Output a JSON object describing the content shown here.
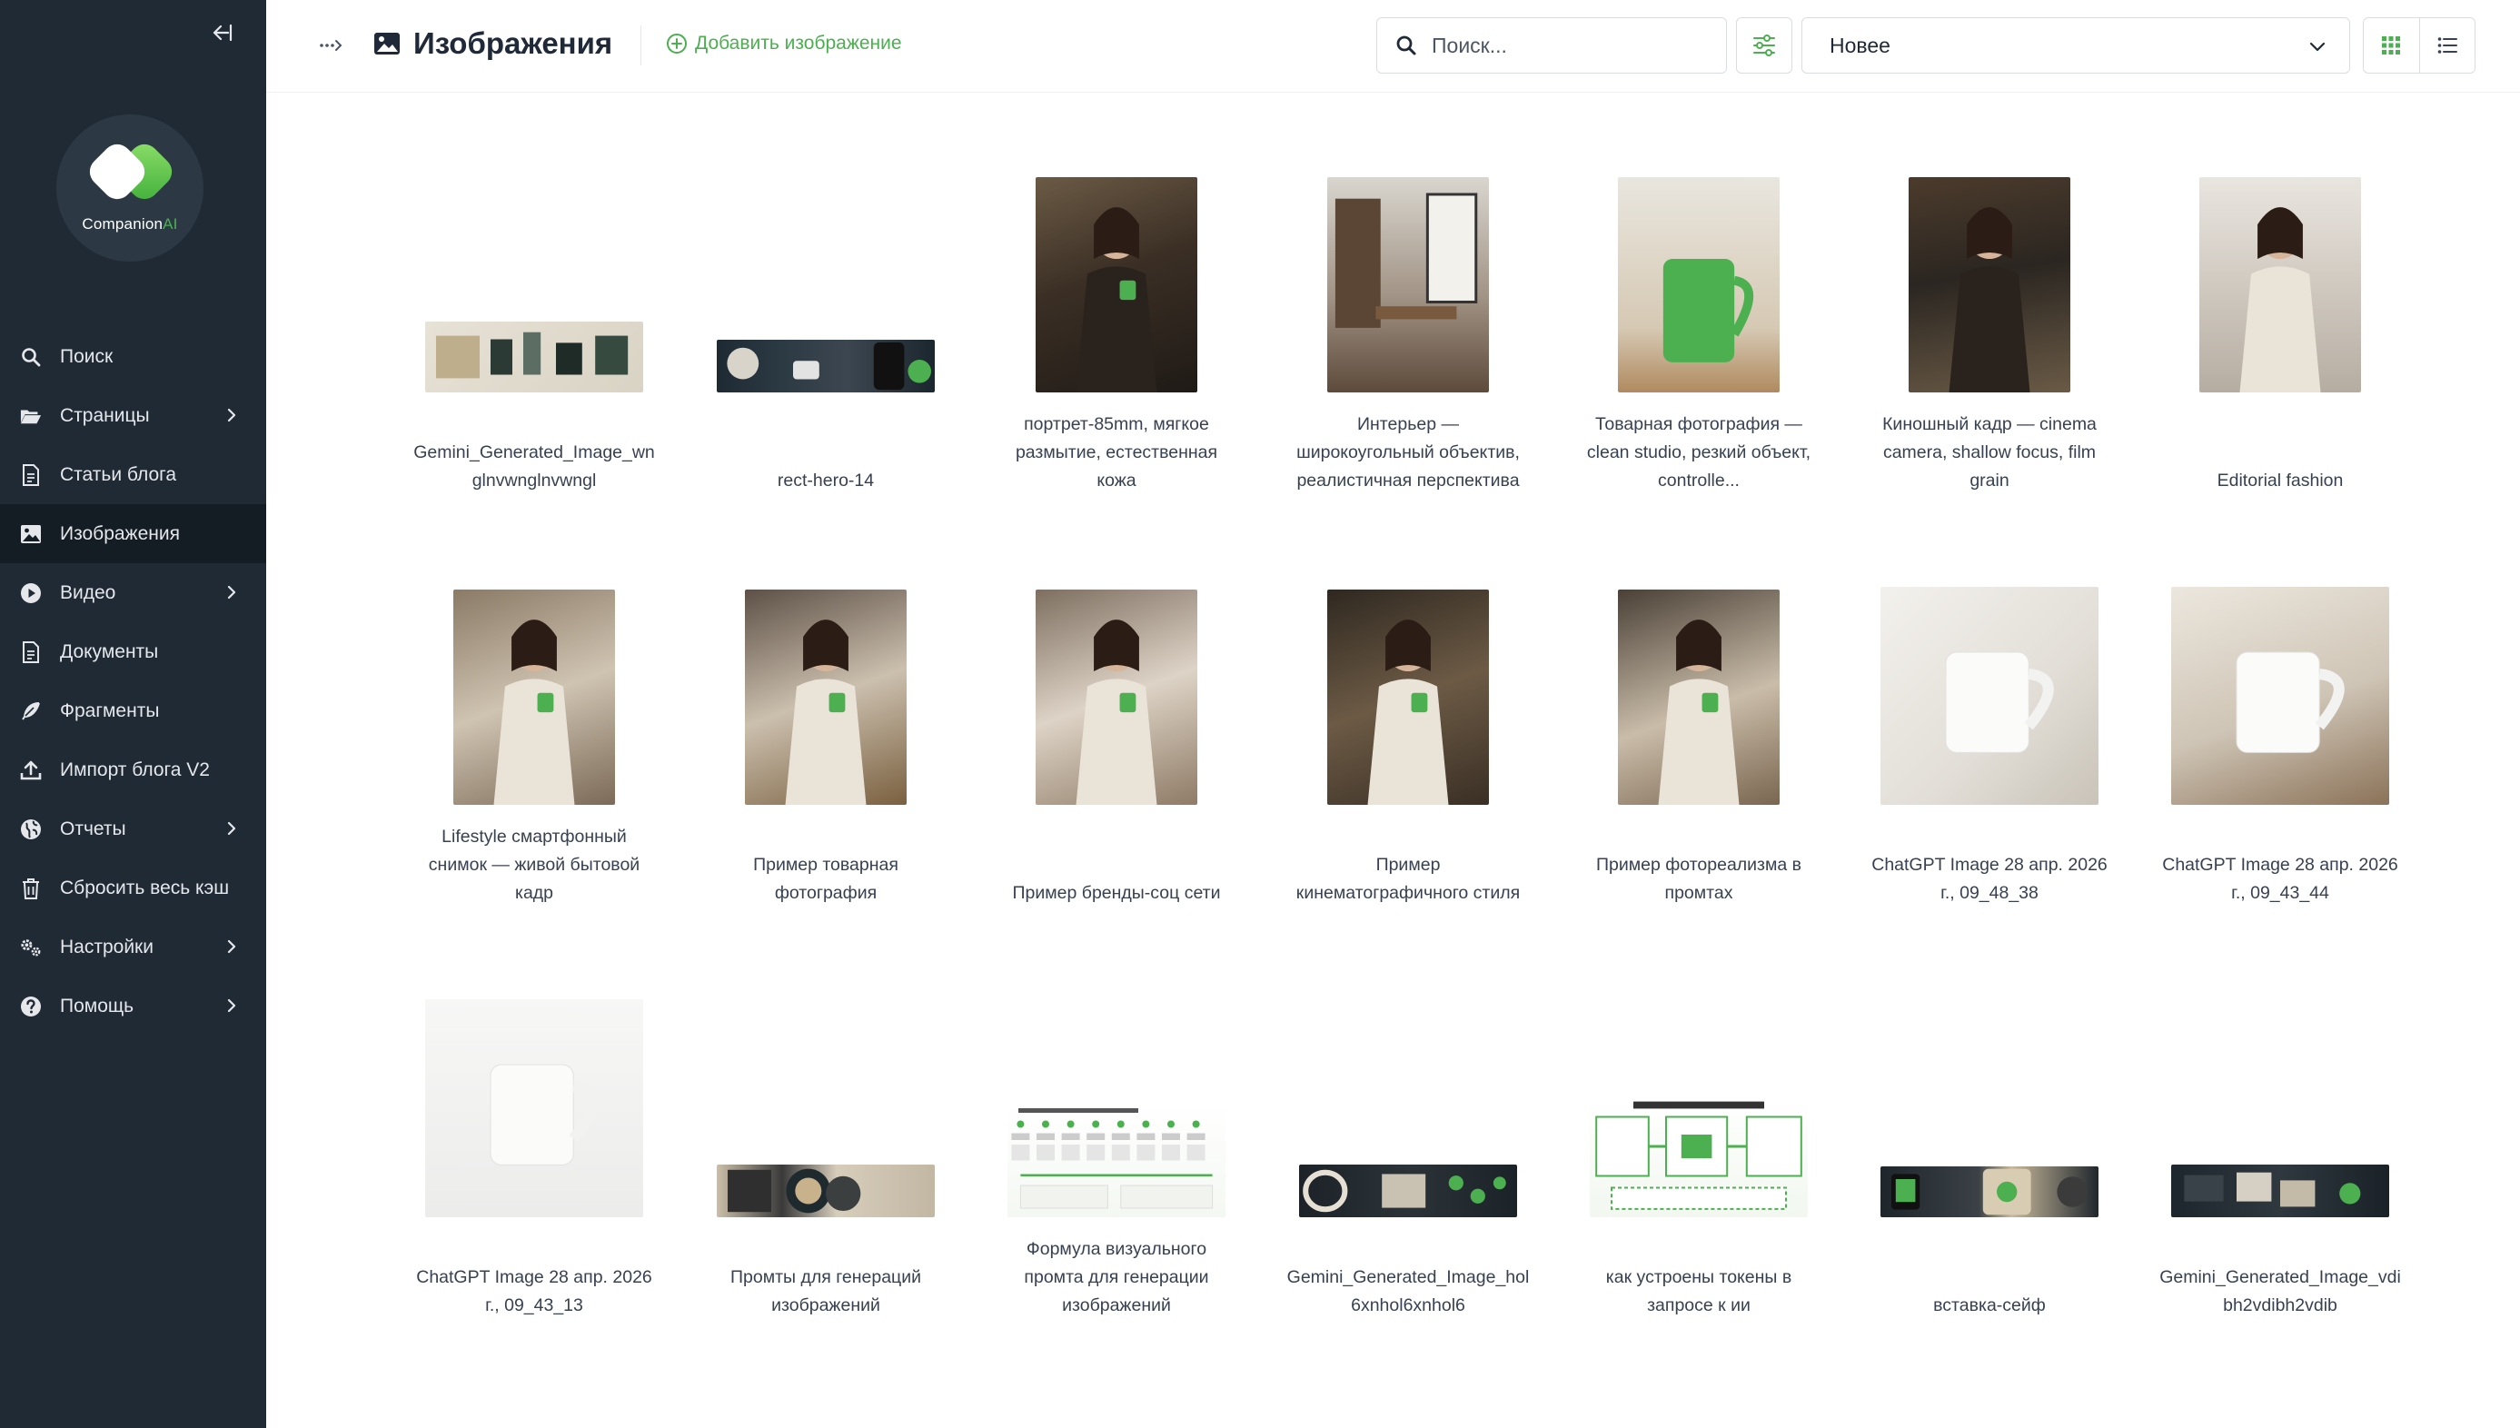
{
  "brand": {
    "name_main": "Companion",
    "name_ai": "AI"
  },
  "sidebar": {
    "items": [
      {
        "label": "Поиск",
        "icon": "search-icon",
        "chevron": false,
        "active": false
      },
      {
        "label": "Страницы",
        "icon": "folder-open-icon",
        "chevron": true,
        "active": false
      },
      {
        "label": "Статьи блога",
        "icon": "document-icon",
        "chevron": false,
        "active": false
      },
      {
        "label": "Изображения",
        "icon": "image-icon",
        "chevron": false,
        "active": true
      },
      {
        "label": "Видео",
        "icon": "play-icon",
        "chevron": true,
        "active": false
      },
      {
        "label": "Документы",
        "icon": "document-icon",
        "chevron": false,
        "active": false
      },
      {
        "label": "Фрагменты",
        "icon": "feather-icon",
        "chevron": false,
        "active": false
      },
      {
        "label": "Импорт блога V2",
        "icon": "upload-icon",
        "chevron": false,
        "active": false
      },
      {
        "label": "Отчеты",
        "icon": "globe-icon",
        "chevron": true,
        "active": false
      },
      {
        "label": "Сбросить весь кэш",
        "icon": "trash-icon",
        "chevron": false,
        "active": false
      },
      {
        "label": "Настройки",
        "icon": "gears-icon",
        "chevron": true,
        "active": false
      },
      {
        "label": "Помощь",
        "icon": "help-icon",
        "chevron": true,
        "active": false
      }
    ]
  },
  "header": {
    "title": "Изображения",
    "add_label": "Добавить изображение",
    "search_placeholder": "Поиск...",
    "sort_value": "Новее"
  },
  "colors": {
    "sidebar": "#1f2a35",
    "sidebar_active": "#141c24",
    "accent": "#4caf50"
  },
  "images": [
    {
      "caption": [
        "Gemini_Generated_Image_wn",
        "glnvwnglnvwngl"
      ],
      "shape": "wide",
      "tone": "light-objects"
    },
    {
      "caption": [
        "rect-hero-14"
      ],
      "shape": "banner",
      "tone": "dark-robot"
    },
    {
      "caption": [
        "портрет-85mm, мягкое",
        "размытие, естественная",
        "кожа"
      ],
      "shape": "tall",
      "tone": "warm-portrait"
    },
    {
      "caption": [
        "Интерьер —",
        "широкоугольный объектив,",
        "реалистичная перспектива"
      ],
      "shape": "tall",
      "tone": "interior"
    },
    {
      "caption": [
        "Товарная фотография —",
        "clean studio, резкий объект,",
        "controlle..."
      ],
      "shape": "tall",
      "tone": "green-mug"
    },
    {
      "caption": [
        "Киношный кадр — cinema",
        "camera, shallow focus, film",
        "grain"
      ],
      "shape": "tall",
      "tone": "cinema-street"
    },
    {
      "caption": [
        "Editorial fashion"
      ],
      "shape": "tall",
      "tone": "fashion"
    },
    {
      "caption": [
        "Lifestyle смартфонный",
        "снимок — живой бытовой",
        "кадр"
      ],
      "shape": "tall",
      "tone": "lifestyle"
    },
    {
      "caption": [
        "Пример товарная",
        "фотография"
      ],
      "shape": "tall",
      "tone": "product-woman"
    },
    {
      "caption": [
        "Пример бренды-соц сети"
      ],
      "shape": "tall",
      "tone": "brand-woman"
    },
    {
      "caption": [
        "Пример",
        "кинематографичного стиля"
      ],
      "shape": "tall",
      "tone": "cinematic-woman"
    },
    {
      "caption": [
        "Пример фотореализма в",
        "промтах"
      ],
      "shape": "tall",
      "tone": "photoreal-woman"
    },
    {
      "caption": [
        "ChatGPT Image 28 апр. 2026",
        "г., 09_48_38"
      ],
      "shape": "wide-tall",
      "tone": "white-mug-window"
    },
    {
      "caption": [
        "ChatGPT Image 28 апр. 2026",
        "г., 09_43_44"
      ],
      "shape": "wide-tall",
      "tone": "white-mug-book"
    },
    {
      "caption": [
        "ChatGPT Image 28 апр. 2026",
        "г., 09_43_13"
      ],
      "shape": "square",
      "tone": "white-mug-studio"
    },
    {
      "caption": [
        "Промты для генераций",
        "изображений"
      ],
      "shape": "banner",
      "tone": "beige-collage"
    },
    {
      "caption": [
        "Формула визуального",
        "промта для генерации",
        "изображений"
      ],
      "shape": "infographic",
      "tone": "infographic"
    },
    {
      "caption": [
        "Gemini_Generated_Image_hol",
        "6xnhol6xnhol6"
      ],
      "shape": "banner",
      "tone": "dark-tech"
    },
    {
      "caption": [
        "как устроены токены в",
        "запросе к ии"
      ],
      "shape": "infographic-sq",
      "tone": "token-diagram"
    },
    {
      "caption": [
        "вставка-сейф"
      ],
      "shape": "banner-sm",
      "tone": "safe"
    },
    {
      "caption": [
        "Gemini_Generated_Image_vdi",
        "bh2vdibh2vdib"
      ],
      "shape": "banner",
      "tone": "dark-iso"
    }
  ]
}
